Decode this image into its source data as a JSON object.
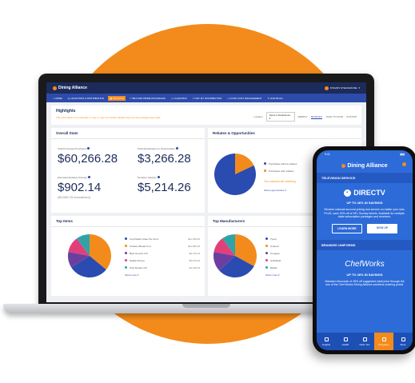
{
  "colors": {
    "accent": "#f38b1c",
    "navy": "#1c2b5a",
    "blue": "#2d4baa",
    "phone_blue": "#2d6bd8",
    "pie_navy": "#2a4bb0",
    "pie_orange": "#f38b1c",
    "pie_purple": "#6b3fa0",
    "pie_pink": "#e0407a",
    "pie_teal": "#2fa3a8"
  },
  "app": {
    "brand": "Dining Alliance",
    "user": "STEVE'S STEAKHOUSE"
  },
  "nav": [
    {
      "label": "HOME",
      "icon": "home-icon"
    },
    {
      "label": "LOCATIONS & DISTRIBUTION",
      "icon": "location-icon"
    },
    {
      "label": "INSIGHTS",
      "icon": "chart-icon",
      "active": true
    },
    {
      "label": "BEYOND PRIME PROGRAMS",
      "icon": "star-icon"
    },
    {
      "label": "CLAIM BOX",
      "icon": "box-icon"
    },
    {
      "label": "PAY MY DISTRIBUTION",
      "icon": "card-icon"
    },
    {
      "label": "FOOD COST MANAGEMENT",
      "icon": "tag-icon"
    },
    {
      "label": "OUR BLOG",
      "icon": "blog-icon"
    }
  ],
  "highlights": {
    "title": "Highlights",
    "note": "This information is an estimate. It may or may not include rebates that you have already been paid.",
    "location_label": "Location",
    "location_value": "Steve's Steakhouse",
    "tabs": [
      "WEEKLY",
      "MONTHLY",
      "YEAR TO DATE",
      "CUSTOM"
    ],
    "active_tab": "MONTHLY"
  },
  "overall_stats": {
    "title": "Overall Stats",
    "stats": [
      {
        "label": "Total Processed Purchases",
        "value": "$60,266.28"
      },
      {
        "label": "Potential Rebates for Opportunities",
        "value": "$3,266.28"
      },
      {
        "label": "Estimated Rebates Savings",
        "value": "$902.14",
        "sub": "($9,056.78 annualized)"
      },
      {
        "label": "Donation Savings",
        "value": "$5,214.26"
      }
    ]
  },
  "rebates": {
    "title": "Rebates & Opportunities",
    "legend": [
      "Purchases without rebates",
      "Purchases with rebates"
    ],
    "note": "You should be earning",
    "show_more": "Show opportunities",
    "pie_fractions": [
      0.18,
      0.82
    ]
  },
  "top_items": {
    "title": "Top Items",
    "items": [
      {
        "label": "Cup Plastic Clear Pet 16 oz",
        "value": "$11,156.02"
      },
      {
        "label": "Chicken Breast 6 oz",
        "value": "$11,062.02"
      },
      {
        "label": "Beef Ground 4 lb",
        "value": "$6,743.15"
      },
      {
        "label": "Napkin Dinner",
        "value": "$5,072.23"
      },
      {
        "label": "Pork Roasts 4 lb",
        "value": "$4,146.03"
      }
    ],
    "show_more": "Show more",
    "pie_fractions": [
      0.36,
      0.3,
      0.12,
      0.12,
      0.1
    ]
  },
  "top_manufacturers": {
    "title": "Top Manufacturers",
    "filter": "VOLUME",
    "items": [
      "Tyson",
      "Unilever",
      "Conagra",
      "Smithfield",
      "Barilla"
    ],
    "show_more": "Show more",
    "pie_fractions": [
      0.33,
      0.3,
      0.15,
      0.12,
      0.1
    ]
  },
  "phone": {
    "time": "9:41",
    "brand": "Dining Alliance",
    "section1": "TELEVISION SERVICE",
    "directv": "DIRECTV",
    "offer1": "UP TO 46% IN SAVINGS",
    "desc1": "Receive national account pricing and service no matter your size. PLUS, save 20% off of NFL Sunday tickets. Available for multiple-state subscription packages and receivers.",
    "learn_more": "LEARN MORE",
    "signup": "SIGN UP",
    "section2": "BRANDED UNIFORMS",
    "chefworks": "ChefWorks",
    "offer2": "UP TO 46% IN SAVINGS",
    "desc2": "Standard discounts of 45% off suggested retail price through the use of the Chef Works Dining Alliance solutions ordering portal.",
    "tabs": [
      {
        "label": "Insights",
        "icon": "insights-icon"
      },
      {
        "label": "Health",
        "icon": "health-icon"
      },
      {
        "label": "Claim box",
        "icon": "claim-icon"
      },
      {
        "label": "Programs",
        "icon": "programs-icon",
        "active": true
      },
      {
        "label": "More",
        "icon": "more-icon"
      }
    ]
  }
}
